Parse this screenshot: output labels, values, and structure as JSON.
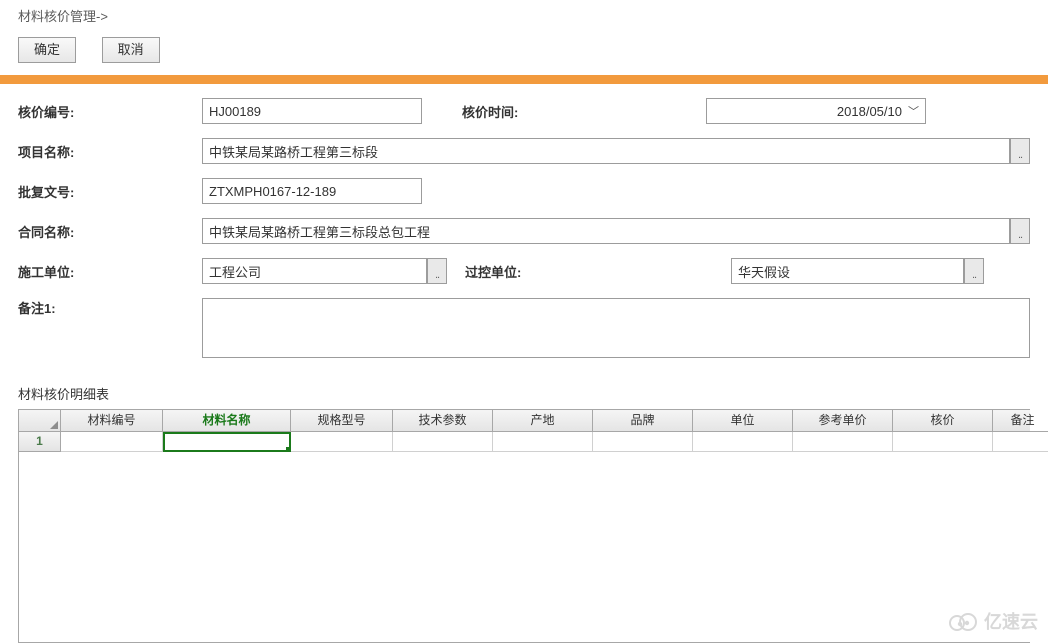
{
  "breadcrumb": "材料核价管理->",
  "buttons": {
    "ok": "确定",
    "cancel": "取消"
  },
  "form": {
    "labels": {
      "code": "核价编号:",
      "time": "核价时间:",
      "project": "项目名称:",
      "approval": "批复文号:",
      "contract": "合同名称:",
      "builder": "施工单位:",
      "controller": "过控单位:",
      "memo1": "备注1:"
    },
    "values": {
      "code": "HJ00189",
      "time": "2018/05/10",
      "project": "中铁某局某路桥工程第三标段",
      "approval": "ZTXMPH0167-12-189",
      "contract": "中铁某局某路桥工程第三标段总包工程",
      "builder": "工程公司",
      "controller": "华天假设",
      "memo1": ""
    }
  },
  "section_title": "材料核价明细表",
  "grid": {
    "headers": {
      "id": "材料编号",
      "name": "材料名称",
      "spec": "规格型号",
      "tech": "技术参数",
      "origin": "产地",
      "brand": "品牌",
      "unit": "单位",
      "ref": "参考单价",
      "price": "核价",
      "memo": "备注"
    },
    "rows": [
      {
        "num": "1",
        "id": "",
        "name": "",
        "spec": "",
        "tech": "",
        "origin": "",
        "brand": "",
        "unit": "",
        "ref": "",
        "price": "",
        "memo": ""
      }
    ]
  },
  "watermark": "亿速云"
}
